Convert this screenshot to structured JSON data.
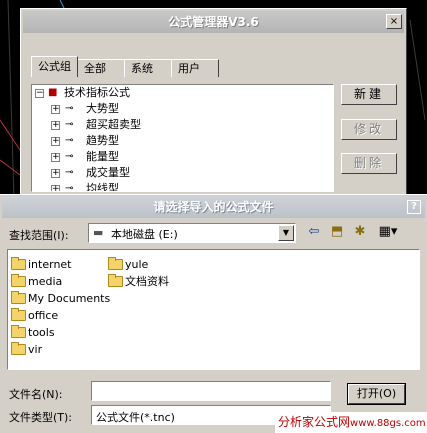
{
  "manager": {
    "title": "公式管理器V3.6",
    "close_glyph": "×",
    "tabs": [
      "公式组",
      "全部",
      "系统",
      "用户"
    ],
    "tree": {
      "root_label": "技术指标公式",
      "root_expander": "−",
      "child_expander": "+",
      "items": [
        "大势型",
        "超买超卖型",
        "趋势型",
        "能量型",
        "成交量型",
        "均线型"
      ]
    },
    "buttons": {
      "new": "新建",
      "modify": "修改",
      "delete": "删除"
    }
  },
  "dialog": {
    "title": "请选择导入的公式文件",
    "help_glyph": "?",
    "look_in_label": "查找范围(I):",
    "look_in_value": "本地磁盘 (E:)",
    "toolbar_icons": [
      "back-arrow-icon",
      "up-folder-icon",
      "new-folder-icon",
      "view-menu-icon"
    ],
    "folders_col1": [
      "internet",
      "media",
      "My Documents",
      "office",
      "tools",
      "vir"
    ],
    "folders_col2": [
      "yule",
      "文档资料"
    ],
    "filename_label": "文件名(N):",
    "filename_value": "",
    "filetype_label": "文件类型(T):",
    "filetype_value": "公式文件(*.tnc)",
    "open_button": "打开(O)"
  },
  "watermark": {
    "brand": "分析家公式网",
    "url": "www.88gs.com"
  },
  "colors": {
    "title_text": "#ffffff",
    "window_face": "#d4d0c8",
    "folder": "#f2d46a",
    "watermark_text": "#c00000"
  }
}
